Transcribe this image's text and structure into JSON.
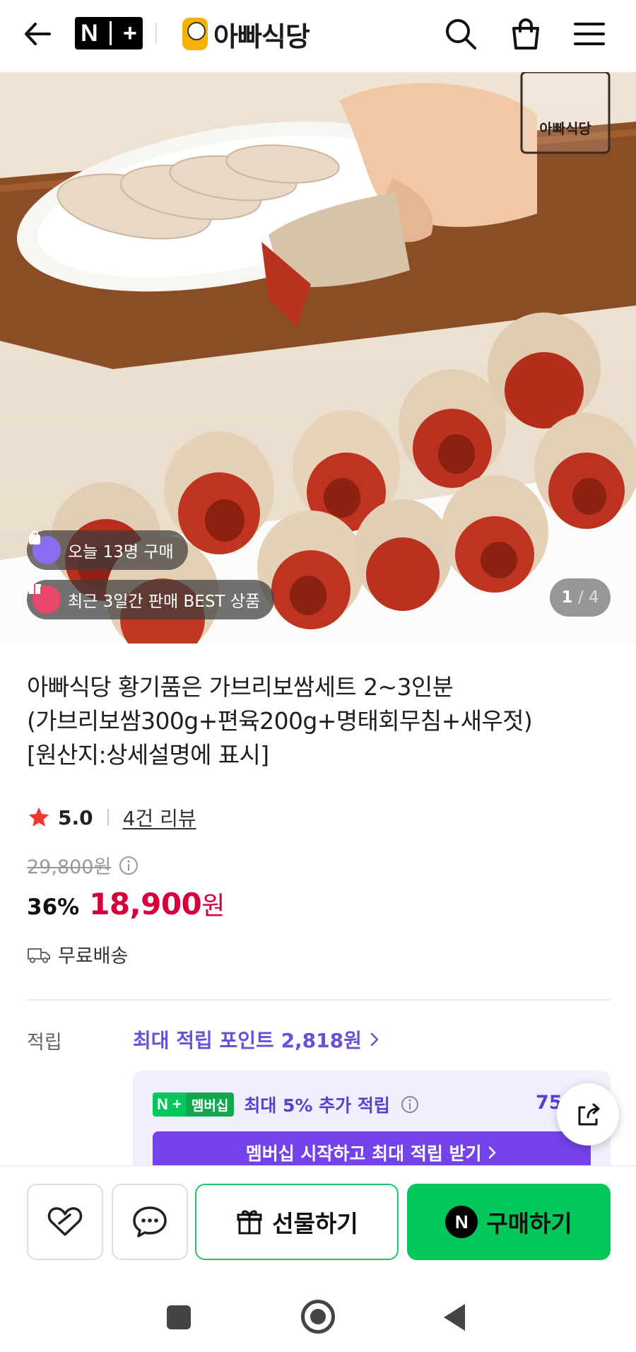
{
  "header": {
    "nplus_logo": "N+",
    "brand_name": "아빠식당",
    "icons": [
      "back-arrow-icon",
      "search-icon",
      "shopping-bag-icon",
      "menu-icon"
    ]
  },
  "hero": {
    "watermark": "아빠식당",
    "badges": [
      {
        "icon": "bag-icon",
        "text": "오늘 13명 구매",
        "color": "#8b6cf0"
      },
      {
        "icon": "gift-icon",
        "text": "최근 3일간 판매 BEST 상품",
        "color": "#e8476a"
      }
    ],
    "pager": {
      "current": "1",
      "total": "/ 4"
    }
  },
  "product": {
    "title_lines": [
      "아빠식당 황기품은 가브리보쌈세트 2~3인분",
      "(가브리보쌈300g+편육200g+명태회무침+새우젓)",
      "[원산지:상세설명에 표시]"
    ],
    "rating": "5.0",
    "reviews": "4건 리뷰",
    "original_price": "29,800원",
    "discount": "36%",
    "price": "18,900",
    "price_unit": "원",
    "shipping": "무료배송"
  },
  "points": {
    "label": "적립",
    "max_points": "최대 적립 포인트 2,818원",
    "member_tag_left": "N +",
    "member_tag_right": "멤버십",
    "member_text": "최대 5% 추가 적립",
    "member_amount": "75",
    "member_cta": "멤버십 시작하고 최대 적립 받기"
  },
  "actions": {
    "gift": "선물하기",
    "buy": "구매하기",
    "buy_logo": "N"
  },
  "colors": {
    "price_red": "#d5003b",
    "naver_green": "#03c75a",
    "membership_purple": "#7342e8",
    "link_purple": "#6b4fd8"
  }
}
